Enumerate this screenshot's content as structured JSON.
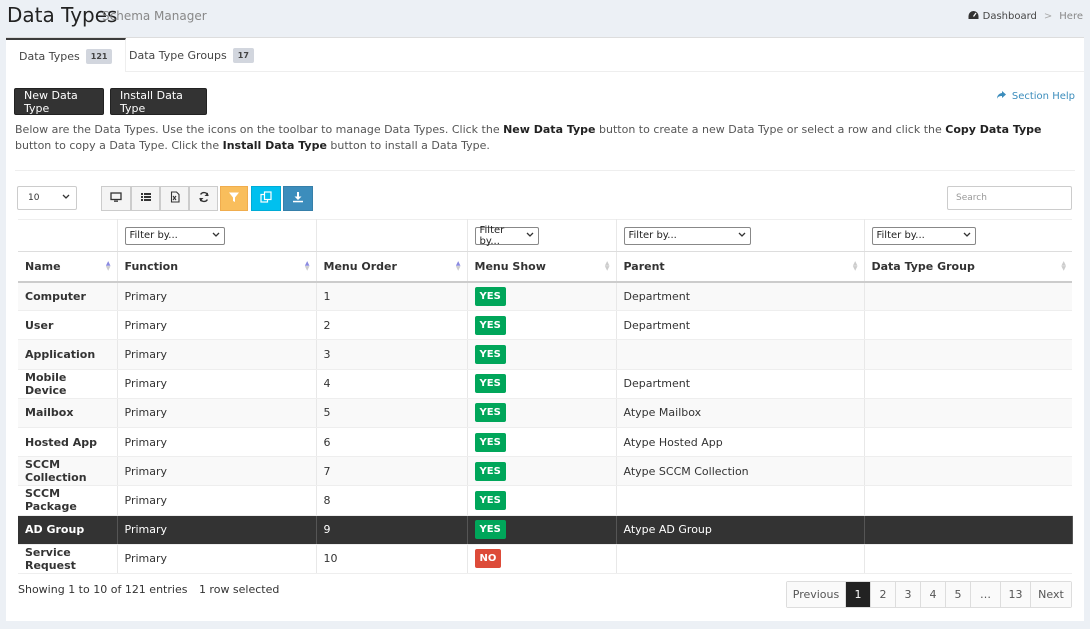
{
  "header": {
    "title": "Data Types",
    "subtitle": "Schema Manager"
  },
  "breadcrumb": {
    "home": "Dashboard",
    "separator": ">",
    "current": "Here"
  },
  "tabs": [
    {
      "label": "Data Types",
      "count": "121"
    },
    {
      "label": "Data Type Groups",
      "count": "17"
    }
  ],
  "buttons": {
    "new": "New Data Type",
    "install": "Install Data Type",
    "help": "Section Help"
  },
  "description": {
    "p1": "Below are the Data Types. Use the icons on the toolbar to manage Data Types. Click the ",
    "b1": "New Data Type",
    "p2": " button to create a new Data Type or select a row and click the ",
    "b2": "Copy Data Type",
    "p3": " button to copy a Data Type. Click the ",
    "b3": "Install Data Type",
    "p4": " button to install a Data Type."
  },
  "page_length": "10",
  "search": {
    "placeholder": "Search"
  },
  "filter_label": "Filter by...",
  "columns": [
    "Name",
    "Function",
    "Menu Order",
    "Menu Show",
    "Parent",
    "Data Type Group"
  ],
  "rows": [
    {
      "name": "Computer",
      "function": "Primary",
      "order": "1",
      "show": "YES",
      "parent": "Department",
      "group": ""
    },
    {
      "name": "User",
      "function": "Primary",
      "order": "2",
      "show": "YES",
      "parent": "Department",
      "group": ""
    },
    {
      "name": "Application",
      "function": "Primary",
      "order": "3",
      "show": "YES",
      "parent": "",
      "group": ""
    },
    {
      "name": "Mobile Device",
      "function": "Primary",
      "order": "4",
      "show": "YES",
      "parent": "Department",
      "group": ""
    },
    {
      "name": "Mailbox",
      "function": "Primary",
      "order": "5",
      "show": "YES",
      "parent": "Atype Mailbox",
      "group": ""
    },
    {
      "name": "Hosted App",
      "function": "Primary",
      "order": "6",
      "show": "YES",
      "parent": "Atype Hosted App",
      "group": ""
    },
    {
      "name": "SCCM Collection",
      "function": "Primary",
      "order": "7",
      "show": "YES",
      "parent": "Atype SCCM Collection",
      "group": ""
    },
    {
      "name": "SCCM Package",
      "function": "Primary",
      "order": "8",
      "show": "YES",
      "parent": "",
      "group": ""
    },
    {
      "name": "AD Group",
      "function": "Primary",
      "order": "9",
      "show": "YES",
      "parent": "Atype AD Group",
      "group": "",
      "selected": true
    },
    {
      "name": "Service Request",
      "function": "Primary",
      "order": "10",
      "show": "NO",
      "parent": "",
      "group": ""
    }
  ],
  "footer": {
    "info": "Showing 1 to 10 of 121 entries",
    "selected": "1 row selected"
  },
  "pagination": [
    "Previous",
    "1",
    "2",
    "3",
    "4",
    "5",
    "…",
    "13",
    "Next"
  ],
  "colors": {
    "yes": "#00a65a",
    "no": "#dd4b39",
    "filter_btn": "#f9be5c",
    "copy_btn": "#00c0ef",
    "download_btn": "#3c8dbc",
    "selected_row": "#333333"
  },
  "toolbar_icons": [
    "desktop-icon",
    "list-icon",
    "excel-icon",
    "refresh-icon",
    "filter-icon",
    "copy-icon",
    "download-icon"
  ]
}
